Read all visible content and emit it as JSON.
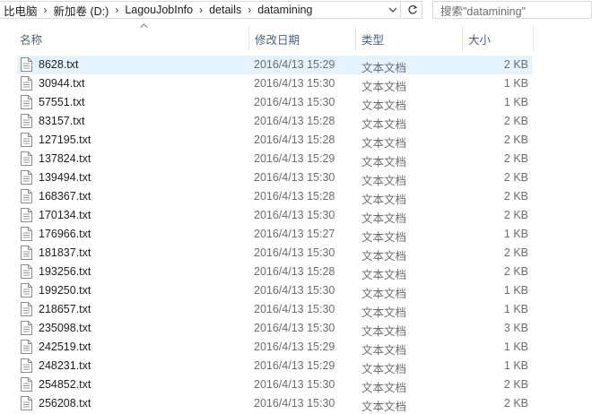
{
  "address": {
    "crumbs": [
      "比电脑",
      "新加卷 (D:)",
      "LagouJobInfo",
      "details",
      "datamining"
    ],
    "separator": "›"
  },
  "search": {
    "placeholder": "搜索\"datamining\""
  },
  "columns": {
    "name": "名称",
    "date": "修改日期",
    "type": "类型",
    "size": "大小"
  },
  "files": [
    {
      "name": "8628.txt",
      "date": "2016/4/13 15:29",
      "type": "文本文档",
      "size": "2 KB"
    },
    {
      "name": "30944.txt",
      "date": "2016/4/13 15:30",
      "type": "文本文档",
      "size": "1 KB"
    },
    {
      "name": "57551.txt",
      "date": "2016/4/13 15:30",
      "type": "文本文档",
      "size": "1 KB"
    },
    {
      "name": "83157.txt",
      "date": "2016/4/13 15:28",
      "type": "文本文档",
      "size": "2 KB"
    },
    {
      "name": "127195.txt",
      "date": "2016/4/13 15:28",
      "type": "文本文档",
      "size": "2 KB"
    },
    {
      "name": "137824.txt",
      "date": "2016/4/13 15:29",
      "type": "文本文档",
      "size": "2 KB"
    },
    {
      "name": "139494.txt",
      "date": "2016/4/13 15:30",
      "type": "文本文档",
      "size": "2 KB"
    },
    {
      "name": "168367.txt",
      "date": "2016/4/13 15:28",
      "type": "文本文档",
      "size": "2 KB"
    },
    {
      "name": "170134.txt",
      "date": "2016/4/13 15:30",
      "type": "文本文档",
      "size": "2 KB"
    },
    {
      "name": "176966.txt",
      "date": "2016/4/13 15:27",
      "type": "文本文档",
      "size": "1 KB"
    },
    {
      "name": "181837.txt",
      "date": "2016/4/13 15:30",
      "type": "文本文档",
      "size": "2 KB"
    },
    {
      "name": "193256.txt",
      "date": "2016/4/13 15:28",
      "type": "文本文档",
      "size": "2 KB"
    },
    {
      "name": "199250.txt",
      "date": "2016/4/13 15:30",
      "type": "文本文档",
      "size": "1 KB"
    },
    {
      "name": "218657.txt",
      "date": "2016/4/13 15:30",
      "type": "文本文档",
      "size": "1 KB"
    },
    {
      "name": "235098.txt",
      "date": "2016/4/13 15:30",
      "type": "文本文档",
      "size": "3 KB"
    },
    {
      "name": "242519.txt",
      "date": "2016/4/13 15:29",
      "type": "文本文档",
      "size": "1 KB"
    },
    {
      "name": "248231.txt",
      "date": "2016/4/13 15:29",
      "type": "文本文档",
      "size": "1 KB"
    },
    {
      "name": "254852.txt",
      "date": "2016/4/13 15:30",
      "type": "文本文档",
      "size": "2 KB"
    },
    {
      "name": "256208.txt",
      "date": "2016/4/13 15:30",
      "type": "文本文档",
      "size": "2 KB"
    }
  ],
  "icons": {
    "file": "text-file-icon",
    "refresh": "refresh-icon",
    "dropdown": "chevron-down-icon",
    "sort": "sort-ascending-icon"
  },
  "colors": {
    "hover_row": "#e5f3ff",
    "header_text": "#4c607a",
    "meta_text": "#6d6d6d"
  }
}
